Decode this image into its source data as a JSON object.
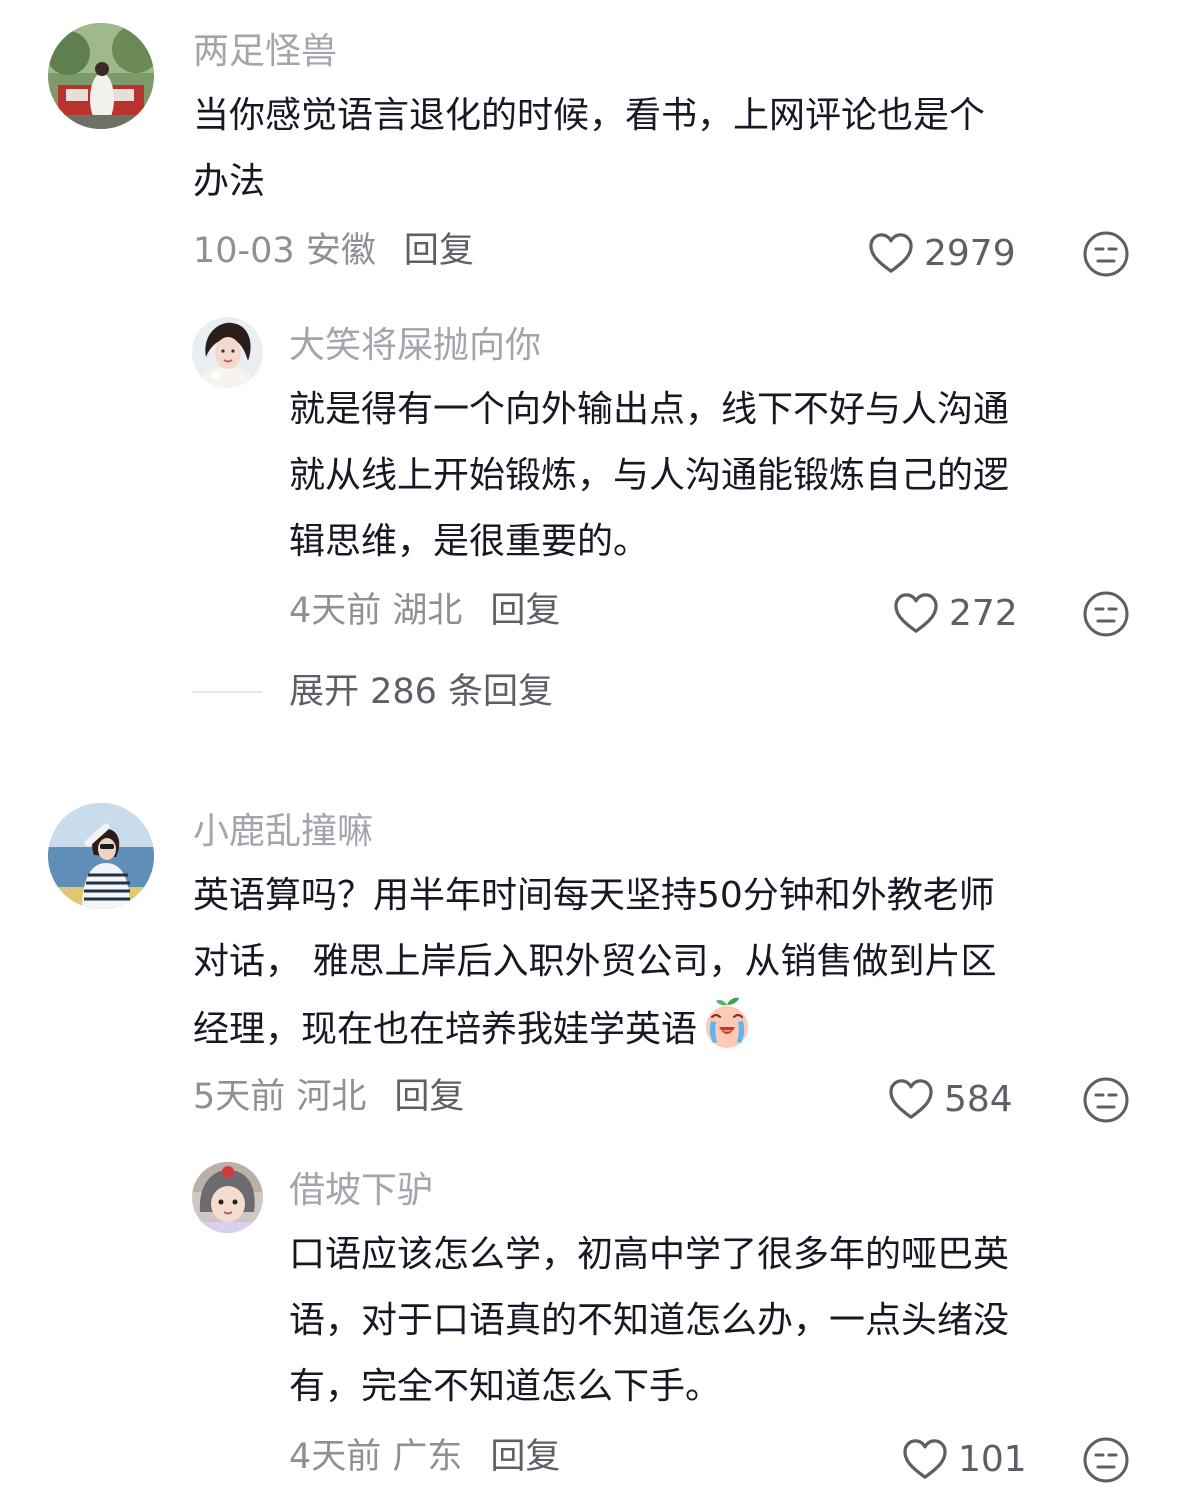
{
  "comments": [
    {
      "user": "两足怪兽",
      "lines": [
        "当你感觉语言退化的时候，看书，上网评论也是个",
        "办法"
      ],
      "time_location": "10-03 安徽",
      "reply_label": "回复",
      "likes": "2979",
      "replies": [
        {
          "user": "大笑将屎抛向你",
          "lines": [
            "就是得有一个向外输出点，线下不好与人沟通",
            "就从线上开始锻炼，与人沟通能锻炼自己的逻",
            "辑思维，是很重要的。"
          ],
          "time_location": "4天前 湖北",
          "reply_label": "回复",
          "likes": "272"
        }
      ],
      "expand_label": "展开 286 条回复"
    },
    {
      "user": "小鹿乱撞嘛",
      "lines": [
        "英语算吗？用半年时间每天坚持50分钟和外教老师",
        "对话， 雅思上岸后入职外贸公司，从销售做到片区",
        "经理，现在也在培养我娃学英语"
      ],
      "emoji_name": "crying-peach-emoji",
      "time_location": "5天前 河北",
      "reply_label": "回复",
      "likes": "584",
      "replies": [
        {
          "user": "借坡下驴",
          "lines": [
            "口语应该怎么学，初高中学了很多年的哑巴英",
            "语，对于口语真的不知道怎么办，一点头绪没",
            "有，完全不知道怎么下手。"
          ],
          "time_location": "4天前 广东",
          "reply_label": "回复",
          "likes": "101"
        }
      ]
    }
  ],
  "icons": {
    "like": "heart-outline-icon",
    "dislike": "neutral-face-icon"
  },
  "colors": {
    "username": "#a4a4ac",
    "body_text": "#161823",
    "meta": "#8f9096",
    "action": "#5e5f66"
  }
}
